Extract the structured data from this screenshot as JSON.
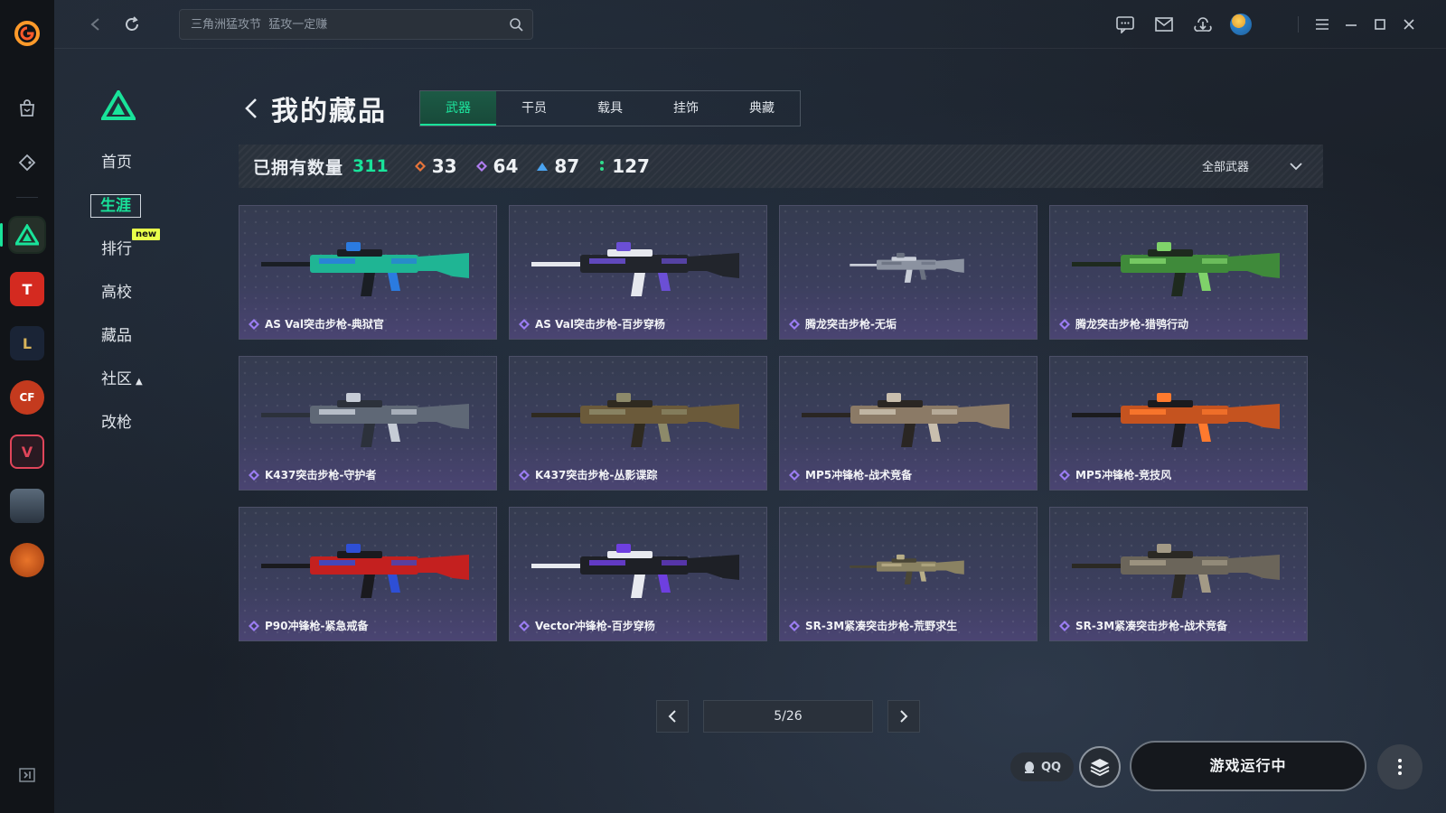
{
  "topbar": {
    "search_placeholder": "三角洲猛攻节  猛攻一定赚"
  },
  "rail": {
    "games": [
      {
        "name": "delta-force",
        "label": ""
      },
      {
        "name": "cf-mobile",
        "label": "T"
      },
      {
        "name": "lol",
        "label": "L"
      },
      {
        "name": "crossfire",
        "label": "CF"
      },
      {
        "name": "valorant",
        "label": "V"
      },
      {
        "name": "pubg",
        "label": ""
      },
      {
        "name": "basketball",
        "label": ""
      }
    ]
  },
  "sidebar": {
    "items": [
      {
        "label": "首页"
      },
      {
        "label": "生涯"
      },
      {
        "label": "排行",
        "badge": "new"
      },
      {
        "label": "高校"
      },
      {
        "label": "藏品"
      },
      {
        "label": "社区"
      },
      {
        "label": "改枪"
      }
    ]
  },
  "header": {
    "title": "我的藏品",
    "tabs": [
      "武器",
      "干员",
      "载具",
      "挂饰",
      "典藏"
    ],
    "active_tab": "武器"
  },
  "stats": {
    "owned_label": "已拥有数量",
    "owned_count": "311",
    "tiers": [
      {
        "color": "#e8743a",
        "value": "33"
      },
      {
        "color": "#b07df0",
        "value": "64"
      },
      {
        "color": "#4aa3f0",
        "value": "87"
      },
      {
        "color": "#2fdc8c",
        "value": "127"
      }
    ],
    "filter_label": "全部武器"
  },
  "colors": {
    "accent": "#19e39a",
    "rarity_purple": "#9b7df2"
  },
  "items": [
    {
      "name": "AS Val突击步枪-典狱官",
      "palette": [
        "#1a1e24",
        "#1fb594",
        "#2b7be0"
      ]
    },
    {
      "name": "AS Val突击步枪-百步穿杨",
      "palette": [
        "#e6e8ee",
        "#22252c",
        "#6b4fd6"
      ]
    },
    {
      "name": "腾龙突击步枪-无垢",
      "palette": [
        "#c9ced8",
        "#8b92a0",
        "#6a7180"
      ]
    },
    {
      "name": "腾龙突击步枪-猎鸮行动",
      "palette": [
        "#1e2a1e",
        "#3f8a3a",
        "#7fd26a"
      ]
    },
    {
      "name": "K437突击步枪-守护者",
      "palette": [
        "#2c313b",
        "#5f6876",
        "#c6ccd6"
      ]
    },
    {
      "name": "K437突击步枪-丛影谍踪",
      "palette": [
        "#2f2a20",
        "#6b5a3a",
        "#8d8a6a"
      ]
    },
    {
      "name": "MP5冲锋枪-战术竞备",
      "palette": [
        "#2a2623",
        "#8b7a66",
        "#c9bfae"
      ]
    },
    {
      "name": "MP5冲锋枪-竞技风",
      "palette": [
        "#1b1b1e",
        "#c5531f",
        "#ff7a2e"
      ]
    },
    {
      "name": "P90冲锋枪-紧急戒备",
      "palette": [
        "#1a1a1e",
        "#c4201f",
        "#2e4fd6"
      ]
    },
    {
      "name": "Vector冲锋枪-百步穿杨",
      "palette": [
        "#e8eaf0",
        "#1e2026",
        "#6e3fe0"
      ]
    },
    {
      "name": "SR-3M紧凑突击步枪-荒野求生",
      "palette": [
        "#4a4636",
        "#8a8262",
        "#b8ae88"
      ]
    },
    {
      "name": "SR-3M紧凑突击步枪-战术竞备",
      "palette": [
        "#2b2924",
        "#6b655a",
        "#a39a86"
      ]
    }
  ],
  "pagination": {
    "page": "5/26"
  },
  "actions": {
    "qq_label": "QQ",
    "run_label": "游戏运行中"
  }
}
